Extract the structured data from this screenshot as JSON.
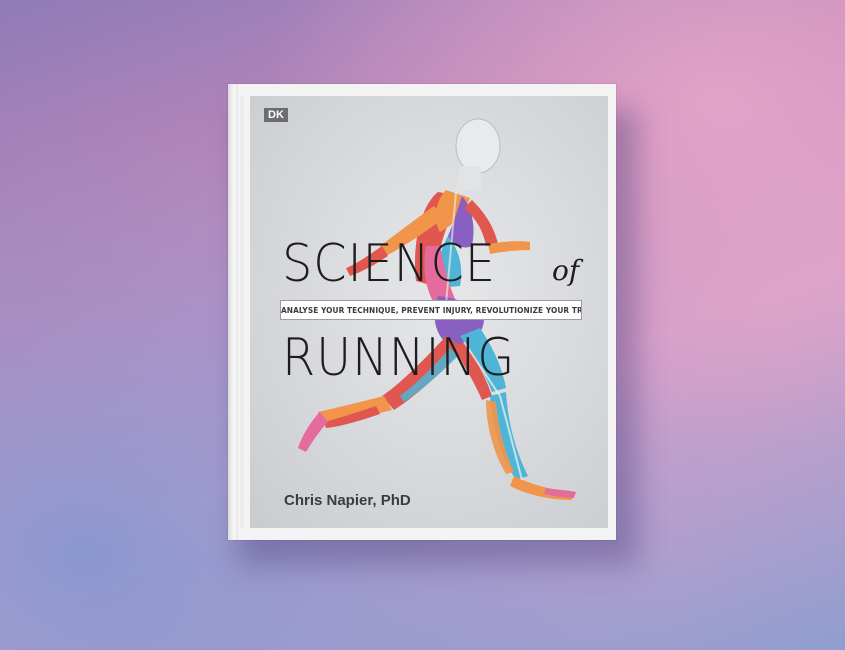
{
  "book": {
    "publisher_logo": "DK",
    "title_line_1": "SCIENCE",
    "title_of": "of",
    "title_line_2": "RUNNING",
    "tagline": "ANALYSE YOUR TECHNIQUE, PREVENT INJURY, REVOLUTIONIZE YOUR TRAINING",
    "author": "Chris Napier, PhD"
  },
  "colors": {
    "background_top": "#c48ab8",
    "background_bottom": "#8f9ed0",
    "cover_background": "#d8d9dc",
    "title_text": "#1d1d1f",
    "muscle_red": "#e0574f",
    "muscle_orange": "#f0954a",
    "muscle_purple": "#8a5fc2",
    "muscle_blue": "#4fb5d6",
    "muscle_pink": "#e56b9c"
  }
}
